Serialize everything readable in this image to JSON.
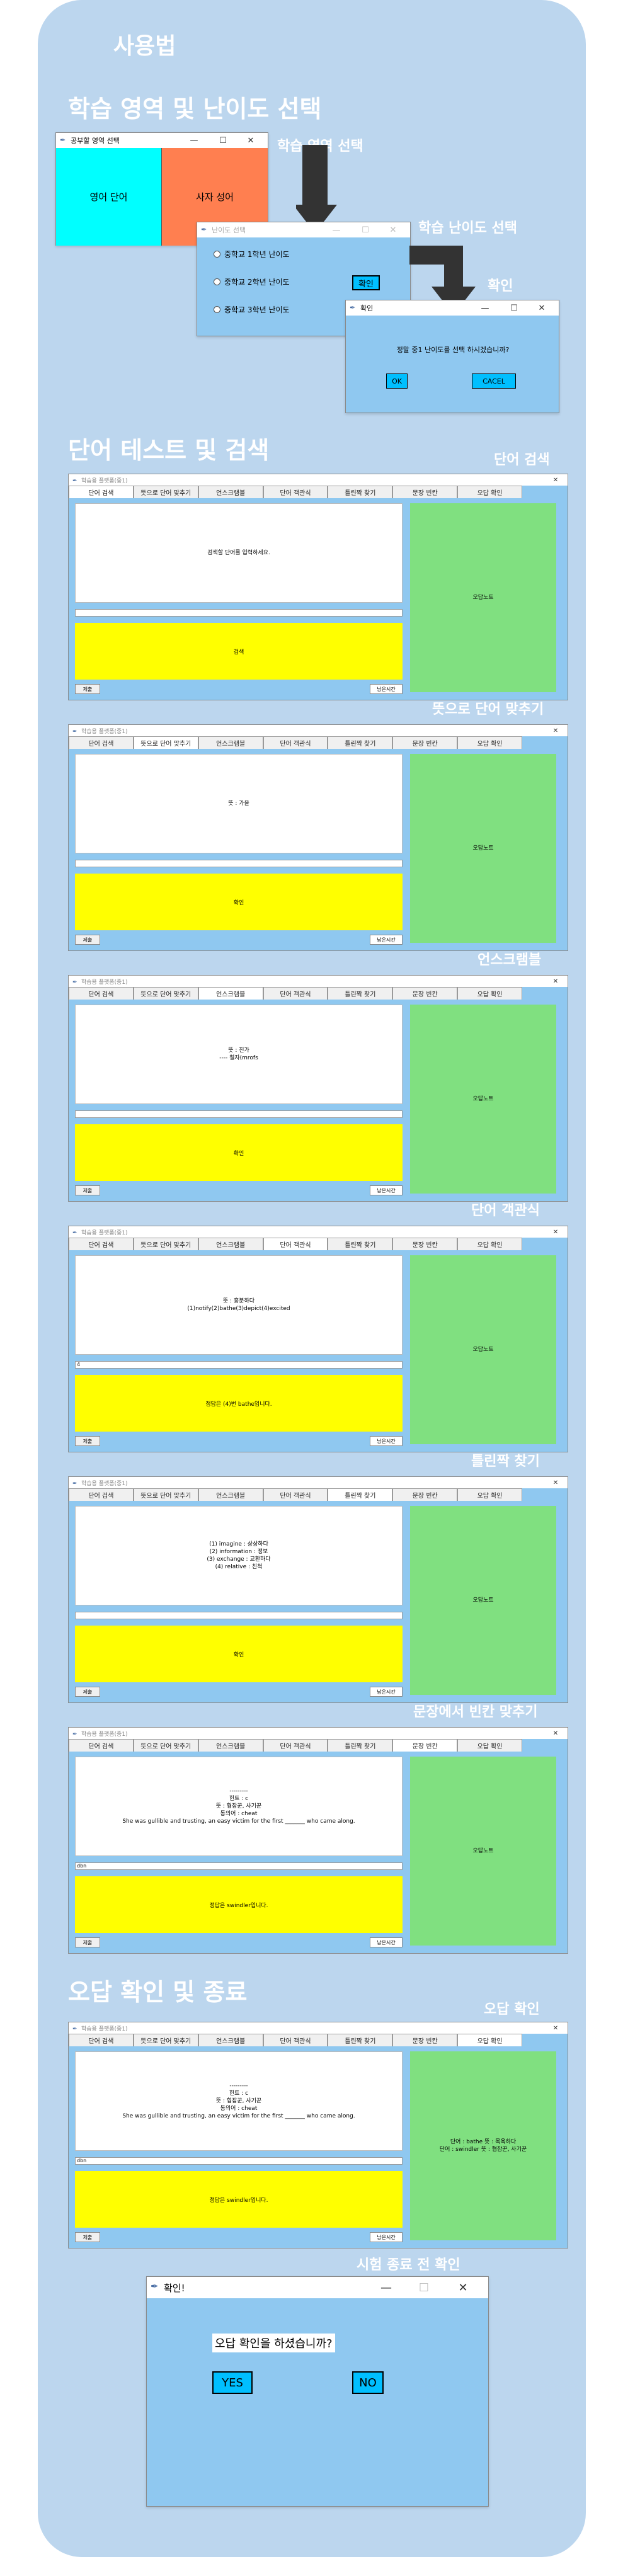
{
  "header": {
    "title": "사용법"
  },
  "section1": {
    "title": "학습 영역 및 난이도 선택",
    "callout_area": "학습 영역 선택",
    "callout_level": "학습 난이도 선택",
    "callout_confirm": "확인",
    "area_window": {
      "title": "공부할 영역 선택",
      "min": "—",
      "max": "☐",
      "close": "✕",
      "btn_english": "영어 단어",
      "btn_idiom": "사자 성어",
      "color_english": "#00ffff",
      "color_idiom": "#ff7f50"
    },
    "level_window": {
      "title": "난이도 선택",
      "min": "—",
      "max": "☐",
      "close": "✕",
      "options": [
        "중학교 1학년 난이도",
        "중학교 2학년 난이도",
        "중학교 3학년 난이도"
      ],
      "confirm": "확인"
    },
    "confirm_window": {
      "title": "확인",
      "min": "—",
      "max": "☐",
      "close": "✕",
      "message": "정말 중1 난이도를 선택 하시겠습니까?",
      "ok": "OK",
      "cancel": "CACEL"
    }
  },
  "section2": {
    "title": "단어 테스트 및 검색"
  },
  "app_common": {
    "tabs": [
      "단어 검색",
      "뜻으로 단어 맞추기",
      "언스크램블",
      "단어 객관식",
      "틀린짝 찾기",
      "문장 빈칸",
      "오답 확인"
    ],
    "submit": "제출",
    "timer": "남은시간",
    "wrong_note": "오답노트",
    "close": "✕"
  },
  "screens": [
    {
      "callout": "단어 검색",
      "title": "학습용 플랫폼(중1)",
      "question": "검색할 단어를 입력하세요.",
      "answer": "",
      "button": "검색",
      "green": "오답노트",
      "selected_tab": 0
    },
    {
      "callout": "뜻으로 단어 맞추기",
      "title": "학습용 플랫폼(중1)",
      "question": "뜻 : 가을",
      "answer": "",
      "button": "확인",
      "green": "오답노트",
      "selected_tab": 1
    },
    {
      "callout": "언스크램블",
      "title": "학습용 플랫폼(중1)",
      "question": "뜻 : 진가\n---- 철자(mrofs",
      "answer": "",
      "button": "확인",
      "green": "오답노트",
      "selected_tab": 2
    },
    {
      "callout": "단어 객관식",
      "title": "학습용 플랫폼(중1)",
      "question": "뜻 : 흥분하다\n(1)notify(2)bathe(3)depict(4)excited",
      "answer": "4",
      "button": "정답은 (4)번 bathe입니다.",
      "green": "오답노트",
      "selected_tab": 3
    },
    {
      "callout": "틀린짝 찾기",
      "title": "학습용 플랫폼(중1)",
      "question": "(1) imagine : 상상하다\n(2) information : 정보\n(3) exchange : 교환하다\n(4) relative : 친척",
      "answer": "",
      "button": "확인",
      "green": "오답노트",
      "selected_tab": 4
    },
    {
      "callout": "문장에서 빈칸 맞추기",
      "title": "학습용 플랫폼(중1)",
      "question": "---------\n힌트 : c\n뜻 : 협잡꾼, 사기꾼\n동의어 : cheat\nShe was gullible and trusting, an easy victim for the first _______ who came along.",
      "answer": "dbn",
      "button": "정답은 swindler입니다.",
      "green": "오답노트",
      "selected_tab": 5
    }
  ],
  "section3": {
    "title": "오답 확인 및 종료",
    "callout_wrong": "오답 확인",
    "callout_exit": "시험 종료 전 확인"
  },
  "wrong_screen": {
    "title": "학습용 플랫폼(중1)",
    "question": "---------\n힌트 : c\n뜻 : 협잡꾼, 사기꾼\n동의어 : cheat\nShe was gullible and trusting, an easy victim for the first _______ who came along.",
    "answer": "dbn",
    "button": "정답은 swindler입니다.",
    "green": "단어 : bathe 뜻 : 목욕하다\n단어 : swindler 뜻 : 협잡꾼, 사기꾼",
    "selected_tab": 6
  },
  "exit_window": {
    "title": "확인!",
    "min": "—",
    "max": "☐",
    "close": "✕",
    "message": "오답 확인을 하셨습니까?",
    "yes": "YES",
    "no": "NO"
  }
}
